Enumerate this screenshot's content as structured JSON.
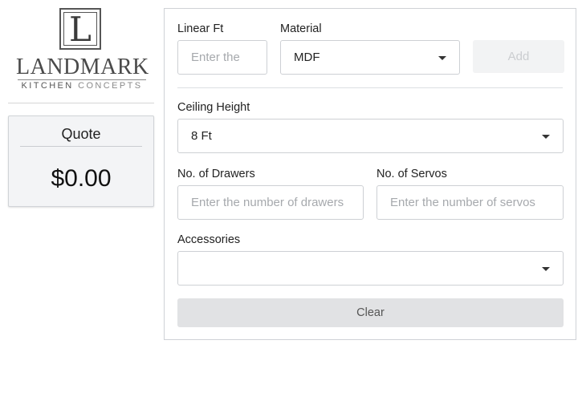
{
  "brand": {
    "logo_letter": "L",
    "name": "LANDMARK",
    "tagline_dark": "KITCHEN",
    "tagline_light": "CONCEPTS"
  },
  "quote": {
    "title": "Quote",
    "amount": "$0.00"
  },
  "form": {
    "linear_ft": {
      "label": "Linear Ft",
      "value": "",
      "placeholder": "Enter the"
    },
    "material": {
      "label": "Material",
      "value": "MDF"
    },
    "add_button": "Add",
    "ceiling_height": {
      "label": "Ceiling Height",
      "value": "8 Ft"
    },
    "drawers": {
      "label": "No. of Drawers",
      "value": "",
      "placeholder": "Enter the number of drawers"
    },
    "servos": {
      "label": "No. of Servos",
      "value": "",
      "placeholder": "Enter the number of servos"
    },
    "accessories": {
      "label": "Accessories",
      "value": ""
    },
    "clear_button": "Clear"
  },
  "icons": {
    "material_caret": "chevron-down-icon",
    "ceiling_caret": "chevron-down-icon",
    "accessories_caret": "chevron-down-icon"
  },
  "colors": {
    "panel_border": "#cfd2d6",
    "quote_bg": "#f3f4f6",
    "disabled_button_bg": "#f2f3f4",
    "clear_button_bg": "#e1e2e4"
  }
}
